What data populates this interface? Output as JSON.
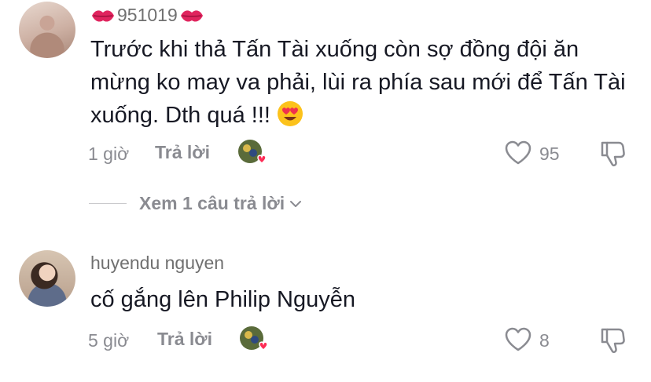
{
  "comments": [
    {
      "username_text": "951019",
      "username_decoration_icon": "kiss-mark-icon",
      "text": "Trước khi thả Tấn Tài xuống còn sợ đồng đội ăn mừng ko may va phải, lùi ra phía sau mới để Tấn Tài xuống. Dth quá !!!",
      "emoji_icon": "heart-eyes-emoji-icon",
      "time": "1 giờ",
      "reply_label": "Trả lời",
      "likes": "95",
      "view_replies_label": "Xem 1 câu trả lời"
    },
    {
      "username_text": "huyendu nguyen",
      "text": "cố gắng lên Philip Nguyễn",
      "time": "5 giờ",
      "reply_label": "Trả lời",
      "likes": "8"
    }
  ],
  "colors": {
    "text": "#161823",
    "muted": "#8a8b91",
    "accent_heart": "#fe2c55"
  }
}
